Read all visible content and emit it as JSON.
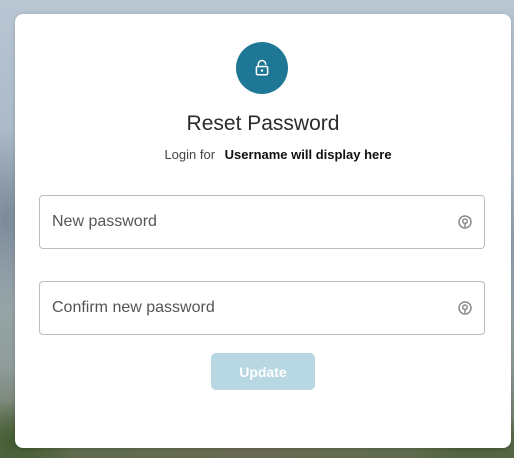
{
  "dialog": {
    "title": "Reset Password",
    "login_prefix": "Login for",
    "username": "Username will display here"
  },
  "fields": {
    "new_password": {
      "value": "",
      "placeholder": "New password"
    },
    "confirm_password": {
      "value": "",
      "placeholder": "Confirm new password"
    }
  },
  "actions": {
    "update_label": "Update",
    "update_enabled": false
  },
  "icons": {
    "header": "lock-icon",
    "toggle": "eye-icon"
  },
  "colors": {
    "accent": "#1f7796",
    "button_disabled": "#b7d7e3"
  }
}
